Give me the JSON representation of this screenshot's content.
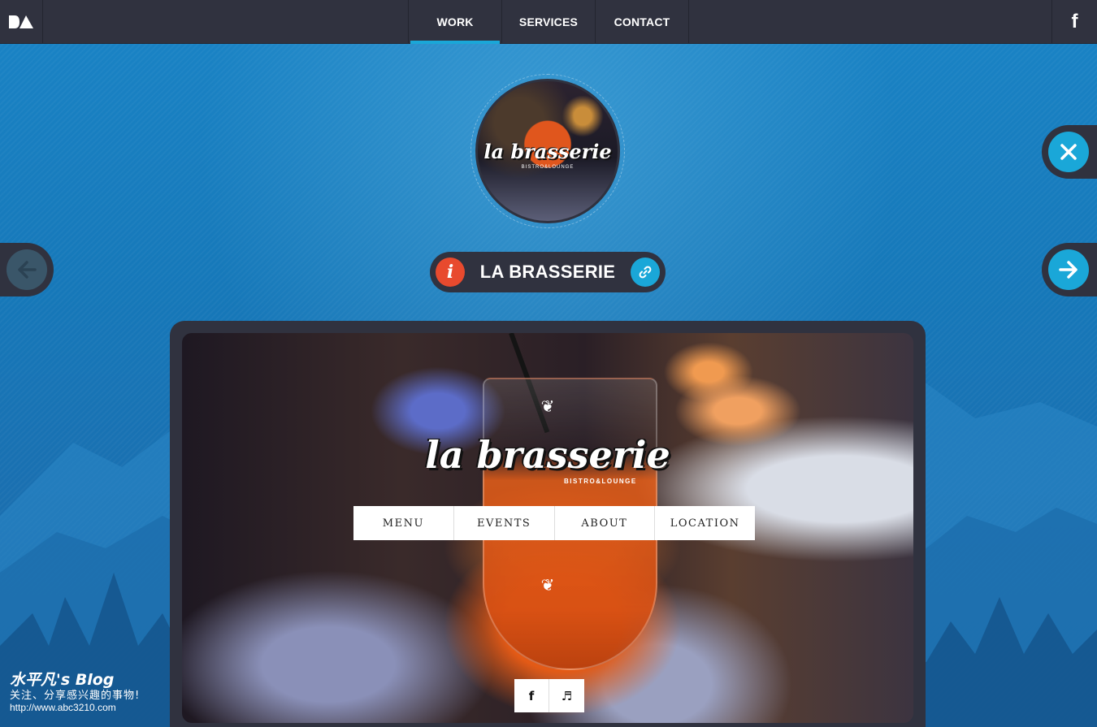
{
  "header": {
    "logo_icon": "brand-logo",
    "nav": [
      {
        "label": "WORK",
        "active": true
      },
      {
        "label": "SERVICES",
        "active": false
      },
      {
        "label": "CONTACT",
        "active": false
      }
    ],
    "social_label": "f",
    "social_icon": "facebook-icon"
  },
  "project": {
    "thumb_logo": "la brasserie",
    "thumb_sub": "BISTRO&LOUNGE",
    "info_label": "i",
    "title": "LA BRASSERIE",
    "link_icon": "link-icon"
  },
  "controls": {
    "close_icon": "close-icon",
    "next_icon": "arrow-right-icon",
    "prev_icon": "arrow-left-icon"
  },
  "preview": {
    "logo": "la brasserie",
    "logo_sub": "BISTRO&LOUNGE",
    "ornament_top": "❦",
    "ornament_bottom": "❦",
    "nav": [
      "MENU",
      "EVENTS",
      "ABOUT",
      "LOCATION"
    ],
    "social": [
      {
        "label": "f",
        "icon": "facebook-icon"
      },
      {
        "label": "♬",
        "icon": "music-icon"
      }
    ]
  },
  "watermark": {
    "title": "水平凡's Blog",
    "subtitle": "关注、分享感兴趣的事物!",
    "url": "http://www.abc3210.com"
  },
  "colors": {
    "background": "#1a78ba",
    "bar": "#30323f",
    "accent": "#1aa7d8",
    "info": "#e84a2e"
  }
}
